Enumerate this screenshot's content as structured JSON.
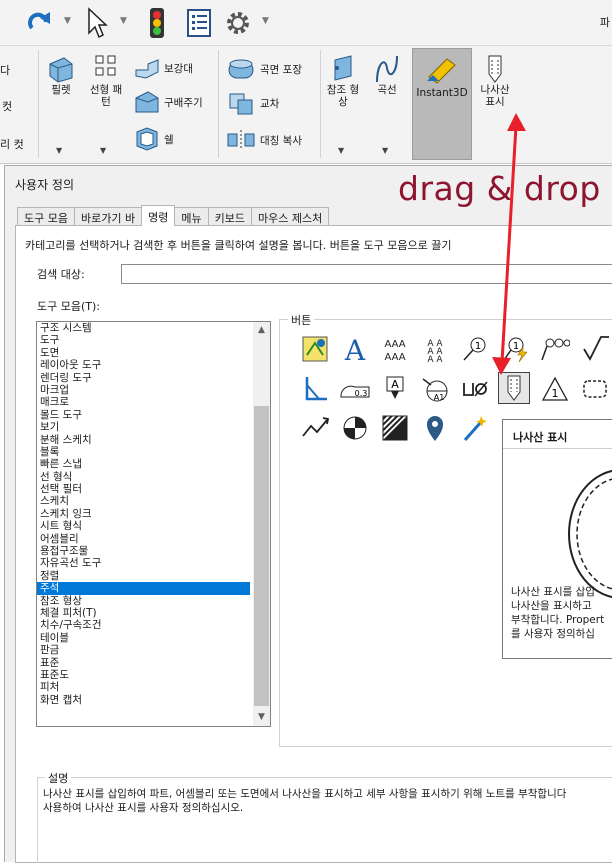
{
  "topbar": {
    "right_text": "파"
  },
  "ribbon": {
    "left_partial": [
      "다",
      "컷",
      "리 컷"
    ],
    "items": {
      "fillet": "필렛",
      "linear_pattern": "선형 패\n턴",
      "rib": "보강대",
      "dome": "구배주기",
      "shell": "쉘",
      "surface_wrap": "곡면 포장",
      "intersect": "교차",
      "mirror": "대칭 복사",
      "ref_geometry": "참조 형\n상",
      "curves": "곡선",
      "instant3d": "Instant3D",
      "thread_display": "나사산\n표시"
    }
  },
  "annotation": {
    "drag_text": "drag & drop",
    "arrow_color": "#e8202a"
  },
  "dialog": {
    "title": "사용자 정의",
    "tabs": [
      "도구 모음",
      "바로가기 바",
      "명령",
      "메뉴",
      "키보드",
      "마우스 제스처"
    ],
    "active_tab": "명령",
    "hint": "카테고리를 선택하거나 검색한 후 버튼을 클릭하여 설명을 봅니다. 버튼을 도구 모음으로 끌기",
    "search_label": "검색 대상:",
    "search_value": "",
    "toolbars_label": "도구 모음(T):",
    "categories": [
      "구조 시스템",
      "도구",
      "도면",
      "레이아웃 도구",
      "렌더링 도구",
      "마크업",
      "매크로",
      "몰드 도구",
      "보기",
      "분해 스케치",
      "블록",
      "빠른 스냅",
      "선 형식",
      "선택 필터",
      "스케치",
      "스케치 잉크",
      "시트 형식",
      "어셈블리",
      "용접구조물",
      "자유곡선 도구",
      "정렬",
      "주석",
      "참조 형상",
      "체결 피처(T)",
      "치수/구속조건",
      "테이블",
      "판금",
      "표준",
      "표준도",
      "피처",
      "화면 캡처"
    ],
    "selected_category": "주석",
    "buttons_label": "버튼",
    "tooltip": {
      "title": "나사산 표시",
      "lines": [
        "나사산 표시를 삽입",
        "나사산을 표시하고",
        "부착합니다. Propert",
        "를 사용자 정의하십"
      ]
    },
    "description_label": "설명",
    "description": [
      "나사산 표시를 삽입하여 파트, 어셈블리 또는 도면에서 나사산을 표시하고 세부 사항을 표시하기 위해 노트를 부착합니다",
      "사용하여 나사산 표시를 사용자 정의하십시오."
    ]
  }
}
